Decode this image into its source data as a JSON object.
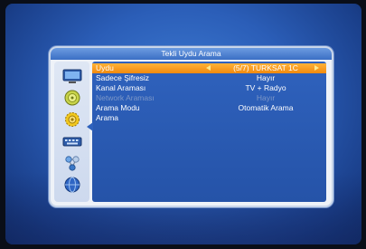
{
  "dialog": {
    "title": "Tekli Uydu Arama"
  },
  "sidebar": {
    "items": [
      {
        "icon": "tv-icon"
      },
      {
        "icon": "satellite-dish-icon"
      },
      {
        "icon": "settings-gear-icon"
      },
      {
        "icon": "keyboard-icon"
      },
      {
        "icon": "network-icon"
      },
      {
        "icon": "globe-icon"
      }
    ]
  },
  "menu": {
    "rows": [
      {
        "label": "Uydu",
        "value": "(5/7) TURKSAT 1C",
        "state": "selected"
      },
      {
        "label": "Sadece Şifresiz",
        "value": "Hayır",
        "state": "normal"
      },
      {
        "label": "Kanal Araması",
        "value": "TV + Radyo",
        "state": "normal"
      },
      {
        "label": "Network Araması",
        "value": "Hayır",
        "state": "disabled"
      },
      {
        "label": "Arama Modu",
        "value": "Otomatik Arama",
        "state": "normal"
      },
      {
        "label": "Arama",
        "value": "",
        "state": "normal"
      }
    ]
  },
  "colors": {
    "selected": "#f28a0e",
    "panel": "#2553a8",
    "title": "#3b6fc5"
  }
}
